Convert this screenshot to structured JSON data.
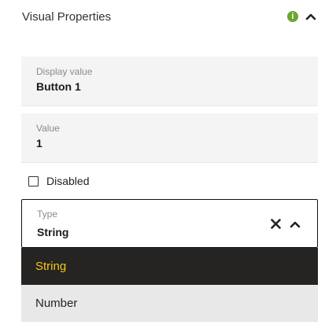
{
  "header": {
    "title": "Visual Properties",
    "info_glyph": "i",
    "info_color": "#6ba62f"
  },
  "fields": {
    "display_value": {
      "label": "Display value",
      "value": "Button 1"
    },
    "value": {
      "label": "Value",
      "value": "1"
    }
  },
  "disabled": {
    "label": "Disabled",
    "checked": false
  },
  "type_select": {
    "label": "Type",
    "value": "String",
    "clear_icon": "close-icon",
    "collapse_icon": "chevron-up-icon"
  },
  "options": [
    {
      "label": "String",
      "selected": true,
      "bg": "#252423"
    },
    {
      "label": "Number",
      "selected": false,
      "bg": "#e8e8e8"
    }
  ],
  "colors": {
    "accent": "#f2c811",
    "dark": "#252423",
    "info": "#6ba62f"
  }
}
